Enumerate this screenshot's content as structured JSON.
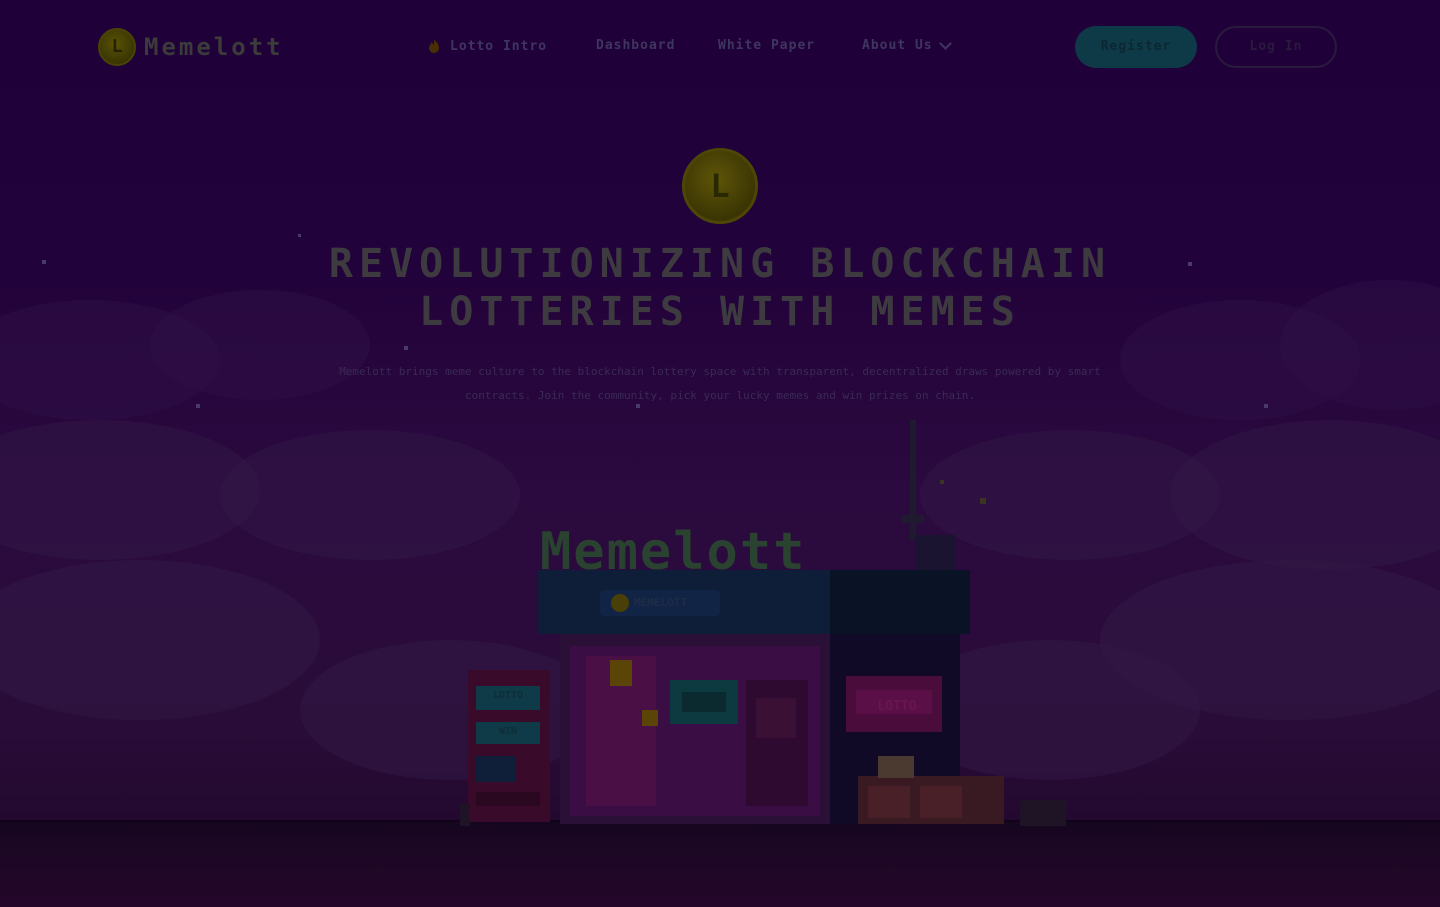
{
  "brand": {
    "name": "Memelott",
    "coin_symbol": "L"
  },
  "nav": {
    "items": [
      {
        "label": "Lotto Intro",
        "icon": "fire-icon"
      },
      {
        "label": "Dashboard"
      },
      {
        "label": "White Paper"
      },
      {
        "label": "About Us",
        "icon": "chevron-down-icon"
      }
    ]
  },
  "actions": {
    "register": "Register",
    "login": "Log In"
  },
  "hero": {
    "coin_symbol": "L",
    "title_line1": "REVOLUTIONIZING BLOCKCHAIN",
    "title_line2": "LOTTERIES WITH MEMES",
    "description": "Memelott brings meme culture to the blockchain lottery space with transparent, decentralized draws powered by smart contracts. Join the community, pick your lucky memes and win prizes on chain."
  },
  "store": {
    "sign": "Memelott",
    "banner": "MEMELOTT",
    "window_sign": "LOTTO",
    "vending_labels": [
      "LOTTO",
      "WIN"
    ]
  },
  "colors": {
    "background": "#200038",
    "accent_teal": "#0e3a48",
    "coin_gold": "#5a5205",
    "store_sign_green": "#2e4a34",
    "store_pink": "#4a1046"
  }
}
